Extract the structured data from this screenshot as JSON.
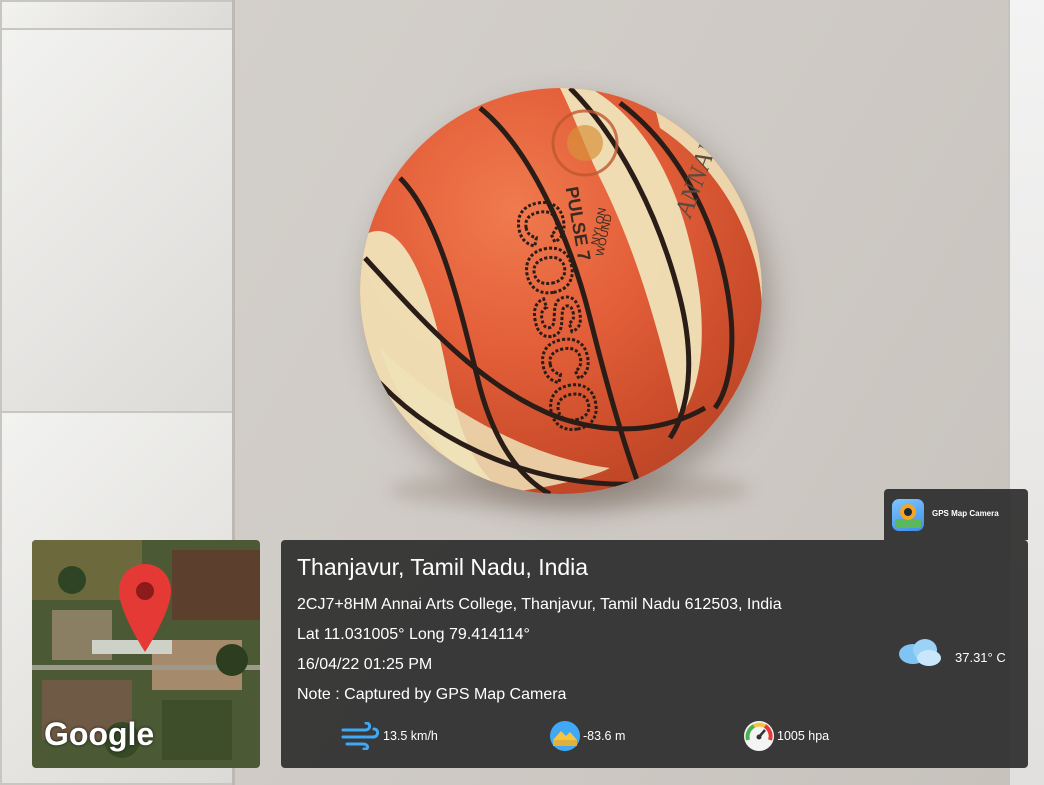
{
  "photo": {
    "subject": "basketball",
    "ball_print": {
      "brand_text": "COSCO",
      "model_text": "PULSE 7",
      "material_text_line1": "NYLON",
      "material_text_line2": "WOUND",
      "partial_text": "ANNAI"
    }
  },
  "map_thumbnail": {
    "provider_label": "Google",
    "pin_color": "#e53935"
  },
  "branding": {
    "app_label": "GPS Map Camera",
    "icon": "gps-camera-app-icon"
  },
  "info": {
    "location_title": "Thanjavur, Tamil Nadu, India",
    "address": "2CJ7+8HM Annai Arts College, Thanjavur, Tamil Nadu 612503, India",
    "coordinates": "Lat 11.031005° Long 79.414114°",
    "datetime": "16/04/22 01:25 PM",
    "note": "Note : Captured by GPS Map Camera"
  },
  "weather": {
    "temperature": "37.31° C",
    "icon": "cloud-icon"
  },
  "metrics": {
    "wind": {
      "value": "13.5 km/h",
      "icon": "wind-icon"
    },
    "altitude": {
      "value": "-83.6 m",
      "icon": "altitude-icon"
    },
    "pressure": {
      "value": "1005 hpa",
      "icon": "pressure-gauge-icon"
    }
  },
  "colors": {
    "panel_bg": "#2e2e2e",
    "ball_orange": "#e4603a",
    "ball_cream": "#efe3b9",
    "text": "#ffffff"
  }
}
